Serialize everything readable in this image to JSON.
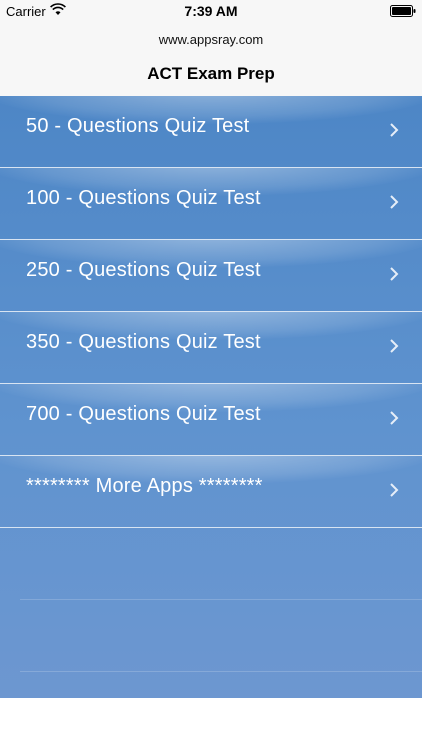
{
  "status": {
    "carrier": "Carrier",
    "time": "7:39 AM"
  },
  "nav": {
    "subtitle": "www.appsray.com",
    "title": "ACT Exam Prep"
  },
  "items": [
    {
      "label": "50 - Questions Quiz Test"
    },
    {
      "label": "100 - Questions Quiz Test"
    },
    {
      "label": "250 - Questions Quiz Test"
    },
    {
      "label": "350 - Questions Quiz Test"
    },
    {
      "label": "700 - Questions Quiz Test"
    },
    {
      "label": "******** More Apps ********"
    }
  ],
  "colors": {
    "table_top": "#4d86c6",
    "table_bottom": "#6d97d0",
    "text": "#ffffff"
  },
  "icons": {
    "wifi": "wifi-icon",
    "battery": "battery-icon",
    "chevron": "chevron-right-icon"
  }
}
